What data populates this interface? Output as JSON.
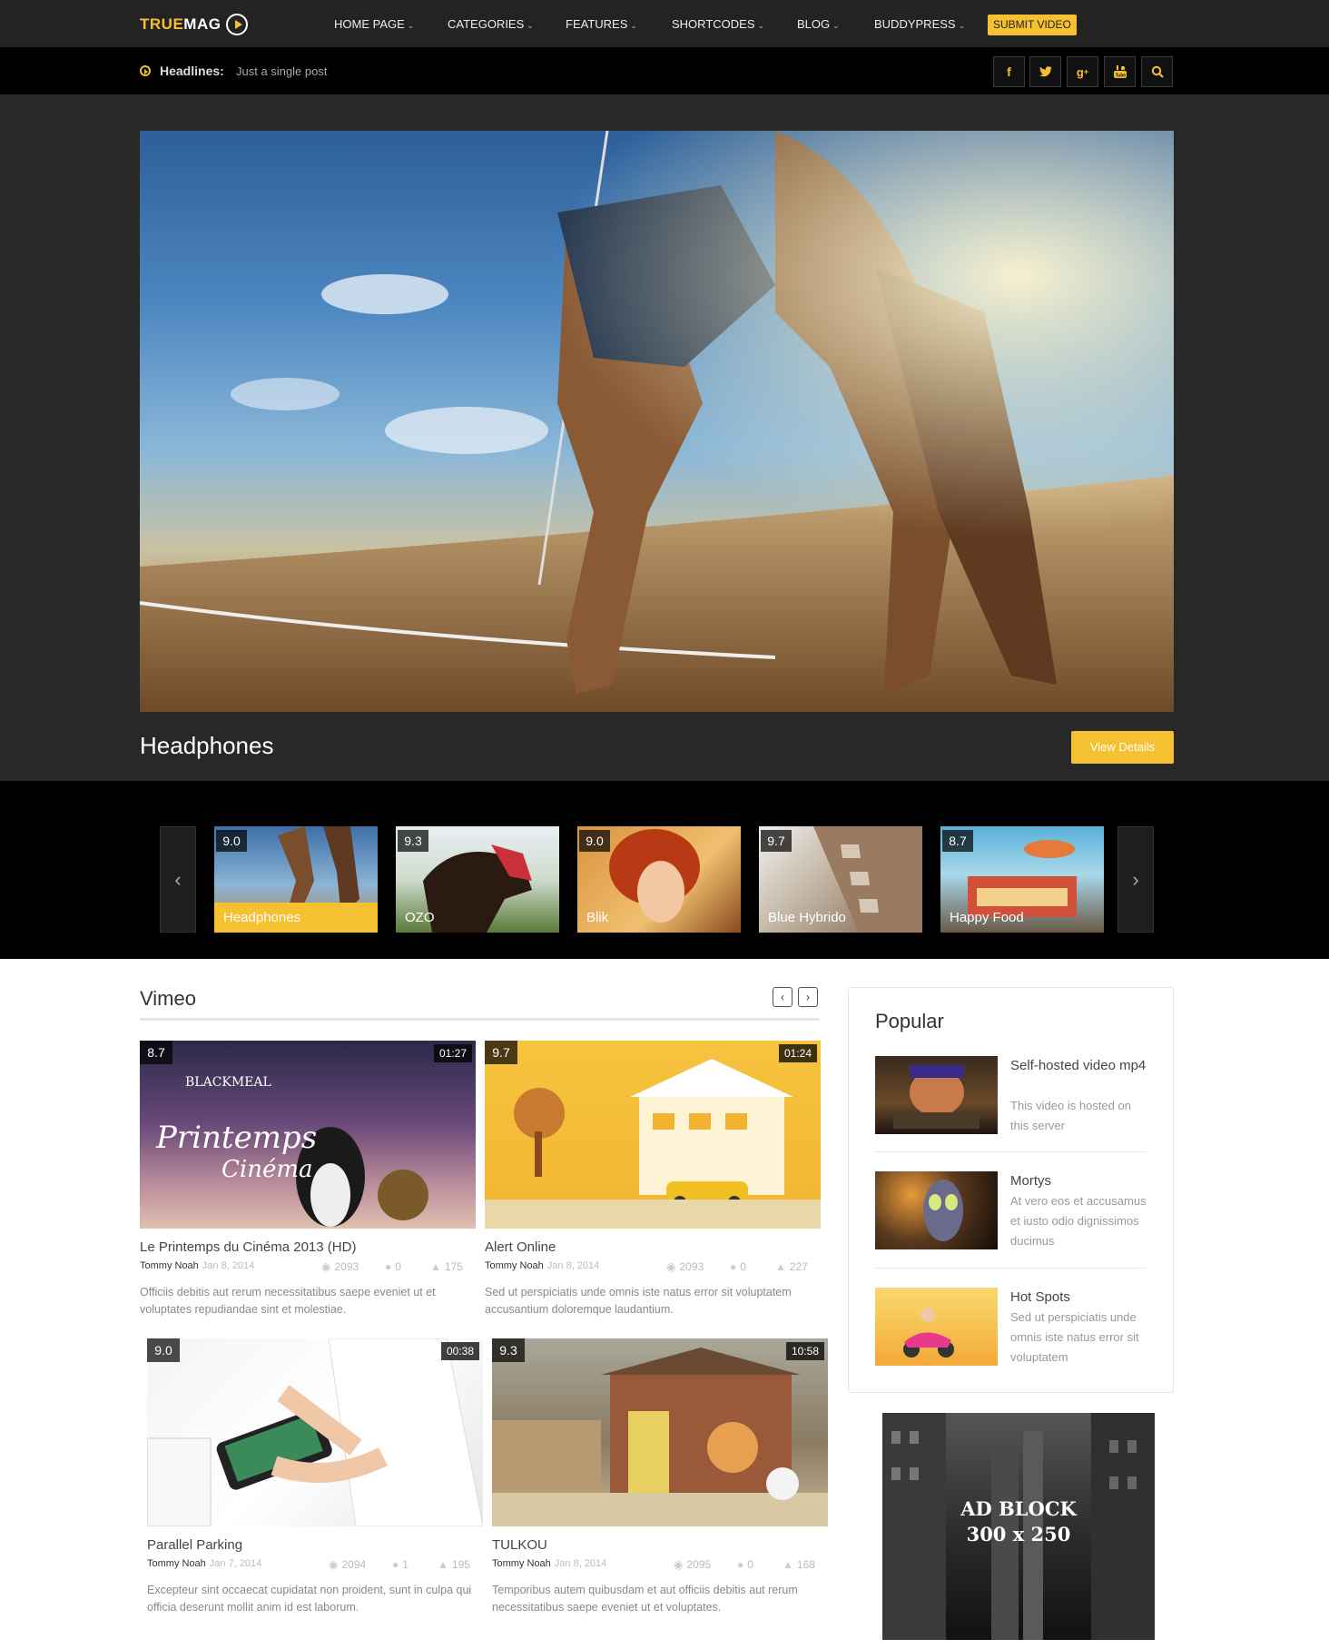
{
  "brand": {
    "name_part1": "TRUE",
    "name_part2": "MAG"
  },
  "nav": {
    "items": [
      "HOME PAGE",
      "CATEGORIES",
      "FEATURES",
      "SHORTCODES",
      "BLOG",
      "BUDDYPRESS"
    ],
    "submit": "SUBMIT VIDEO"
  },
  "headlines": {
    "label": "Headlines:",
    "text": "Just a single post"
  },
  "social": [
    "f",
    "t",
    "g+",
    "yt",
    "search"
  ],
  "hero": {
    "title": "Headphones",
    "button": "View Details"
  },
  "carousel": [
    {
      "score": "9.0",
      "title": "Headphones",
      "active": true
    },
    {
      "score": "9.3",
      "title": "OZO"
    },
    {
      "score": "9.0",
      "title": "Blik"
    },
    {
      "score": "9.7",
      "title": "Blue Hybrido"
    },
    {
      "score": "8.7",
      "title": "Happy Food"
    }
  ],
  "section": {
    "title": "Vimeo"
  },
  "videos": [
    {
      "score": "8.7",
      "duration": "01:27",
      "title": "Le Printemps du Cinéma 2013 (HD)",
      "author": "Tommy Noah",
      "date": "Jan 8, 2014",
      "views": "2093",
      "comments": "0",
      "likes": "175",
      "desc": "Officiis debitis aut rerum necessitatibus saepe eveniet ut et voluptates repudiandae sint et molestiae."
    },
    {
      "score": "9.7",
      "duration": "01:24",
      "title": "Alert Online",
      "author": "Tommy Noah",
      "date": "Jan 8, 2014",
      "views": "2093",
      "comments": "0",
      "likes": "227",
      "desc": "Sed ut perspiciatis unde omnis iste natus error sit voluptatem accusantium doloremque laudantium."
    },
    {
      "score": "9.0",
      "duration": "00:38",
      "title": "Parallel Parking",
      "author": "Tommy Noah",
      "date": "Jan 7, 2014",
      "views": "2094",
      "comments": "1",
      "likes": "195",
      "desc": "Excepteur sint occaecat cupidatat non proident, sunt in culpa qui officia deserunt mollit anim id est laborum."
    },
    {
      "score": "9.3",
      "duration": "10:58",
      "title": "TULKOU",
      "author": "Tommy Noah",
      "date": "Jan 8, 2014",
      "views": "2095",
      "comments": "0",
      "likes": "168",
      "desc": "Temporibus autem quibusdam et aut officiis debitis aut rerum necessitatibus saepe eveniet ut et voluptates."
    }
  ],
  "popular": {
    "title": "Popular",
    "items": [
      {
        "title": "Self-hosted video mp4",
        "desc": "This video is hosted on this server"
      },
      {
        "title": "Mortys",
        "desc": "At vero eos et accusamus et iusto odio dignissimos ducimus"
      },
      {
        "title": "Hot Spots",
        "desc": "Sed ut perspiciatis unde omnis iste natus error sit voluptatem"
      }
    ]
  },
  "ad": {
    "line1": "AD BLOCK",
    "line2": "300 x 250"
  },
  "colors": {
    "accent": "#f5c131",
    "dark": "#232323"
  }
}
